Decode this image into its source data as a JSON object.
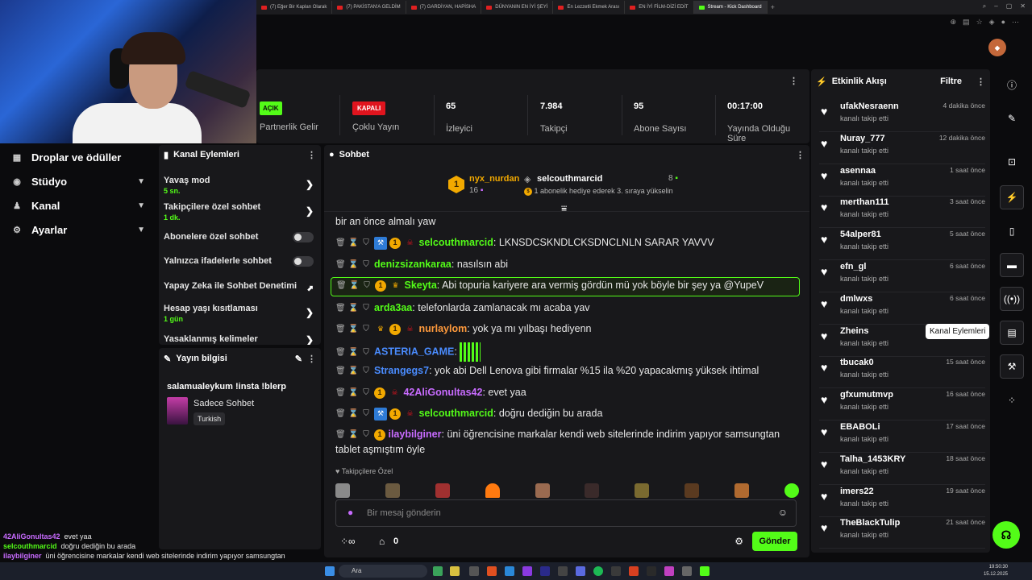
{
  "browser_tabs": [
    {
      "label": "(7) Eğer Bir Kaplan Olarak"
    },
    {
      "label": "(7) PAKİSTAN'A GELDİM"
    },
    {
      "label": "(7) GARDİYAN, HAPİSHA"
    },
    {
      "label": "DÜNYANIN EN İYİ ŞEYİ"
    },
    {
      "label": "En Lezzetli Ekmek Arası"
    },
    {
      "label": "EN İYİ FİLM-DİZİ EDİT"
    },
    {
      "label": "Stream - Kick Dashboard",
      "active": true
    }
  ],
  "left_nav": [
    {
      "icon": "gift-icon",
      "label": "Droplar ve ödüller"
    },
    {
      "icon": "studio-icon",
      "label": "Stüdyo"
    },
    {
      "icon": "channel-icon",
      "label": "Kanal"
    },
    {
      "icon": "gear-icon",
      "label": "Ayarlar"
    }
  ],
  "stats": {
    "partner": {
      "badge": "AÇIK",
      "label": "Partnerlik Gelir"
    },
    "multi": {
      "badge": "KAPALI",
      "label": "Çoklu Yayın"
    },
    "viewers": {
      "value": "65",
      "label": "İzleyici"
    },
    "followers": {
      "value": "7.984",
      "label": "Takipçi"
    },
    "subs": {
      "value": "95",
      "label": "Abone Sayısı"
    },
    "live_time": {
      "value": "00:17:00",
      "label": "Yayında Olduğu Süre"
    }
  },
  "kanal_eylemleri": {
    "title": "Kanal Eylemleri",
    "rows": [
      {
        "label": "Yavaş mod",
        "sub": "5 sn."
      },
      {
        "label": "Takipçilere özel sohbet",
        "sub": "1 dk."
      },
      {
        "label": "Abonelere özel sohbet"
      },
      {
        "label": "Yalnızca ifadelerle sohbet"
      },
      {
        "label": "Yapay Zeka ile Sohbet Denetimi"
      },
      {
        "label": "Hesap yaşı kısıtlaması",
        "sub": "1 gün"
      },
      {
        "label": "Yasaklanmış kelimeler"
      }
    ]
  },
  "yayin_bilgisi": {
    "title": "Yayın bilgisi",
    "stream_title": "salamualeykum !insta !blerp",
    "category": "Sadece Sohbet",
    "tag": "Turkish"
  },
  "sohbet": {
    "title": "Sohbet",
    "pinned": {
      "user1": "nyx_nurdan",
      "user1_count": "16",
      "coin": "1",
      "user2": "selcouthmarcid",
      "user2_count": "8",
      "note": "1 abonelik hediye ederek 3. sıraya yükselin"
    },
    "partial_top": "bir an önce almalı yaw",
    "messages": [
      {
        "user": "selcouthmarcid",
        "color": "#53fc18",
        "text": "LKNSDCSKNDLCKSDNCLNLN SARAR YAVVV"
      },
      {
        "user": "denizsizankaraa",
        "color": "#53fc18",
        "text": "nasılsın abi"
      },
      {
        "user": "Skeyta",
        "color": "#53fc18",
        "text": "Abi topuria kariyere ara vermiş gördün mü yok böyle bir şey ya @YupeV"
      },
      {
        "user": "arda3aa",
        "color": "#53fc18",
        "text": "telefonlarda zamlanacak mı acaba yav"
      },
      {
        "user": "nurlaylom",
        "color": "#ff9a3c",
        "text": "yok ya mı yılbaşı hediyenn"
      },
      {
        "user": "ASTERIA_GAME",
        "color": "#4a8cff",
        "text": ""
      },
      {
        "user": "Strangegs7",
        "color": "#4a8cff",
        "text": "yok abi Dell Lenova gibi firmalar %15 ila %20 yapacakmış yüksek ihtimal"
      },
      {
        "user": "42AliGonultas42",
        "color": "#c86bff",
        "text": "evet yaa"
      },
      {
        "user": "selcouthmarcid",
        "color": "#53fc18",
        "text": "doğru dediğin bu arada"
      },
      {
        "user": "ilaybilginer",
        "color": "#c86bff",
        "text": "üni öğrencisine markalar kendi web sitelerinde indirim yapıyor samsungtan tablet aşmıştım öyle"
      }
    ],
    "followers_only": "Takipçilere Özel",
    "input_placeholder": "Bir mesaj gönderin",
    "points": "0",
    "send": "Gönder"
  },
  "feed": {
    "title": "Etkinlik Akışı",
    "filter": "Filtre",
    "action": "kanalı takip etti",
    "items": [
      {
        "user": "ufakNesraenn",
        "time": "4 dakika önce"
      },
      {
        "user": "Nuray_777",
        "time": "12 dakika önce"
      },
      {
        "user": "asennaa",
        "time": "1 saat önce"
      },
      {
        "user": "merthan111",
        "time": "3 saat önce"
      },
      {
        "user": "54alper81",
        "time": "5 saat önce"
      },
      {
        "user": "efn_gl",
        "time": "6 saat önce"
      },
      {
        "user": "dmlwxs",
        "time": "6 saat önce"
      },
      {
        "user": "Zheins",
        "time": ""
      },
      {
        "user": "tbucak0",
        "time": "15 saat önce"
      },
      {
        "user": "gfxumutmvp",
        "time": "16 saat önce"
      },
      {
        "user": "EBABOLi",
        "time": "17 saat önce"
      },
      {
        "user": "Talha_1453KRY",
        "time": "18 saat önce"
      },
      {
        "user": "imers22",
        "time": "19 saat önce"
      },
      {
        "user": "TheBlackTulip",
        "time": "21 saat önce"
      }
    ]
  },
  "tooltip": "Kanal Eylemleri",
  "overlay_chat": [
    {
      "user": "42AliGonultas42",
      "text": "evet yaa"
    },
    {
      "user": "selcouthmarcid",
      "text": "doğru dediğin bu arada"
    },
    {
      "user": "ilaybilginer",
      "text": "üni öğrencisine markalar kendi web sitelerinde indirim yapıyor samsungtan tablet aşmıştım öyle"
    }
  ],
  "taskbar": {
    "search": "Ara",
    "time": "19:50:30",
    "date": "15.12.2025"
  },
  "colors": {
    "accent": "#53fc18",
    "danger": "#e0141e",
    "panel": "#18181b",
    "bg": "#0b0b0d"
  }
}
